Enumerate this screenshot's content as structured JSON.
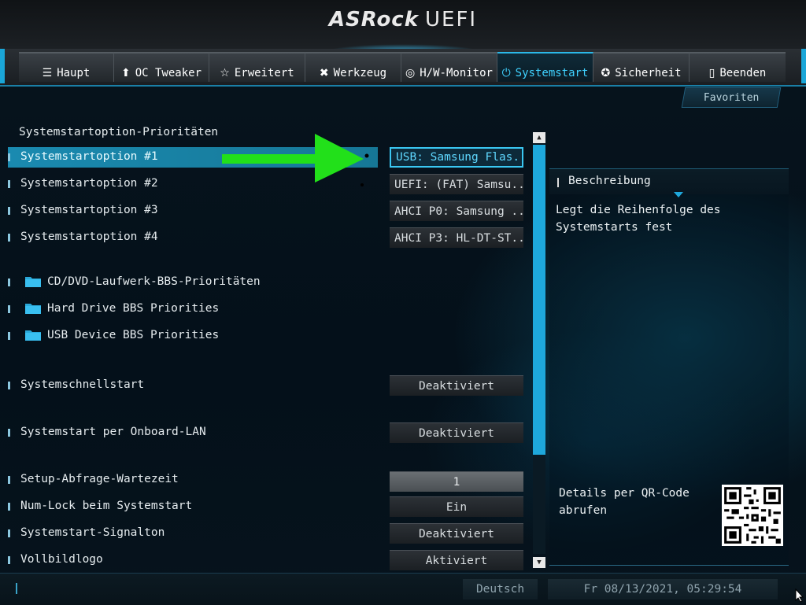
{
  "header": {
    "brand": "ASRock",
    "product": "UEFI"
  },
  "tabs": [
    {
      "label": "Haupt",
      "icon": "list-icon",
      "glyph": "☰",
      "active": false
    },
    {
      "label": "OC Tweaker",
      "icon": "rocket-icon",
      "glyph": "🚀",
      "active": false
    },
    {
      "label": "Erweitert",
      "icon": "star-icon",
      "glyph": "☆",
      "active": false
    },
    {
      "label": "Werkzeug",
      "icon": "wrench-icon",
      "glyph": "✖",
      "active": false
    },
    {
      "label": "H/W-Monitor",
      "icon": "monitor-icon",
      "glyph": "◎",
      "active": false
    },
    {
      "label": "Systemstart",
      "icon": "power-icon",
      "glyph": "⏻",
      "active": true
    },
    {
      "label": "Sicherheit",
      "icon": "shield-icon",
      "glyph": "✪",
      "active": false
    },
    {
      "label": "Beenden",
      "icon": "exit-icon",
      "glyph": "▯",
      "active": false
    }
  ],
  "favorites_label": "Favoriten",
  "section_title": "Systemstartoption-Prioritäten",
  "boot_options": [
    {
      "label": "Systemstartoption #1",
      "value": "USB: Samsung Flas...",
      "selected": true
    },
    {
      "label": "Systemstartoption #2",
      "value": "UEFI: (FAT) Samsu...",
      "selected": false
    },
    {
      "label": "Systemstartoption #3",
      "value": "AHCI P0: Samsung ...",
      "selected": false
    },
    {
      "label": "Systemstartoption #4",
      "value": "AHCI P3: HL-DT-ST...",
      "selected": false
    }
  ],
  "bbs_folders": [
    "CD/DVD-Laufwerk-BBS-Prioritäten",
    "Hard Drive BBS Priorities",
    "USB Device BBS Priorities"
  ],
  "settings": [
    {
      "label": "Systemschnellstart",
      "value": "Deaktiviert"
    },
    {
      "label": "Systemstart per Onboard-LAN",
      "value": "Deaktiviert"
    },
    {
      "label": "Setup-Abfrage-Wartezeit",
      "value": "1"
    },
    {
      "label": "Num-Lock beim Systemstart",
      "value": "Ein"
    },
    {
      "label": "Systemstart-Signalton",
      "value": "Deaktiviert"
    },
    {
      "label": "Vollbildlogo",
      "value": "Aktiviert"
    }
  ],
  "description": {
    "title": "Beschreibung",
    "text": "Legt die Reihenfolge des Systemstarts fest",
    "qr_text": "Details per QR-Code abrufen"
  },
  "footer": {
    "language": "Deutsch",
    "datetime": "Fr 08/13/2021, 05:29:54"
  },
  "colors": {
    "accent": "#1ea8dc",
    "active_tab_text": "#3fd2ff",
    "arrow": "#22e01a"
  }
}
